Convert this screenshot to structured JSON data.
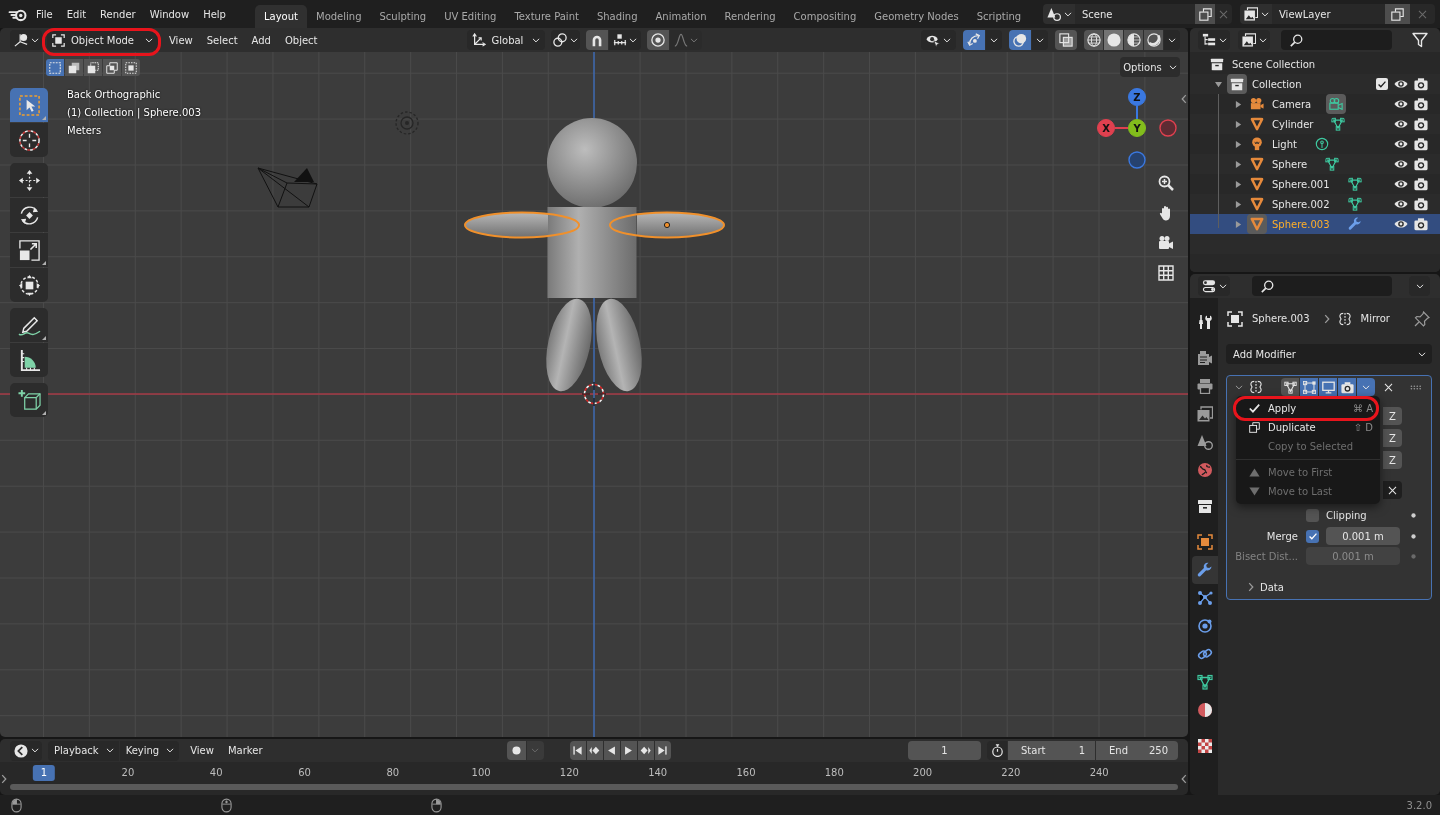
{
  "topbar": {
    "menus": [
      "File",
      "Edit",
      "Render",
      "Window",
      "Help"
    ],
    "workspaces": [
      {
        "label": "Layout",
        "selected": true
      },
      {
        "label": "Modeling",
        "selected": false
      },
      {
        "label": "Sculpting",
        "selected": false
      },
      {
        "label": "UV Editing",
        "selected": false
      },
      {
        "label": "Texture Paint",
        "selected": false
      },
      {
        "label": "Shading",
        "selected": false
      },
      {
        "label": "Animation",
        "selected": false
      },
      {
        "label": "Rendering",
        "selected": false
      },
      {
        "label": "Compositing",
        "selected": false
      },
      {
        "label": "Geometry Nodes",
        "selected": false
      },
      {
        "label": "Scripting",
        "selected": false
      }
    ],
    "scene": "Scene",
    "view_layer": "ViewLayer"
  },
  "viewport": {
    "mode": {
      "label": "Object Mode",
      "annotated": true
    },
    "menus": [
      "View",
      "Select",
      "Add",
      "Object"
    ],
    "orientation": "Global",
    "snap_toggles": [
      {
        "kind": "snap",
        "on": false
      },
      {
        "kind": "proportional",
        "on": false
      }
    ],
    "overlay_toggles": [
      {
        "kind": "gizmos",
        "on": true
      },
      {
        "kind": "overlays",
        "on": true
      },
      {
        "kind": "xray",
        "on": false
      }
    ],
    "shading": [
      {
        "kind": "wireframe",
        "selected": false
      },
      {
        "kind": "solid",
        "selected": true
      },
      {
        "kind": "material",
        "selected": false
      },
      {
        "kind": "rendered",
        "selected": false
      }
    ],
    "select_modes": [
      {
        "kind": "set",
        "selected": true
      },
      {
        "kind": "extend",
        "selected": false
      },
      {
        "kind": "subtract",
        "selected": false
      },
      {
        "kind": "invert",
        "selected": false
      },
      {
        "kind": "intersect",
        "selected": false
      }
    ],
    "options": "Options",
    "tool_groups": [
      {
        "tools": [
          {
            "kind": "select",
            "selected": true,
            "more": true
          },
          {
            "kind": "cursor",
            "selected": false,
            "more": false
          }
        ]
      },
      {
        "tools": [
          {
            "kind": "move",
            "selected": false,
            "more": false
          },
          {
            "kind": "rotate",
            "selected": false,
            "more": false
          },
          {
            "kind": "scale",
            "selected": false,
            "more": true
          },
          {
            "kind": "transform",
            "selected": false,
            "more": false
          }
        ]
      },
      {
        "tools": [
          {
            "kind": "annotate",
            "selected": false,
            "more": true
          },
          {
            "kind": "measure",
            "selected": false,
            "more": false
          }
        ]
      },
      {
        "tools": [
          {
            "kind": "add_cube",
            "selected": false,
            "more": true
          }
        ]
      }
    ],
    "info": [
      "Back Orthographic",
      "(1) Collection | Sphere.003",
      "Meters"
    ],
    "parts": [
      {
        "kind": "head",
        "selected": false,
        "active": false
      },
      {
        "kind": "torso",
        "selected": false,
        "active": false
      },
      {
        "kind": "left_arm",
        "selected": true,
        "active": false
      },
      {
        "kind": "right_arm",
        "selected": true,
        "active": true
      },
      {
        "kind": "left_leg",
        "selected": false,
        "active": false
      },
      {
        "kind": "right_leg",
        "selected": false,
        "active": false
      }
    ],
    "gizmo": [
      {
        "kind": "z",
        "label": "Z"
      },
      {
        "kind": "x",
        "label": "X"
      },
      {
        "kind": "y",
        "label": "Y"
      },
      {
        "kind": "neg_x"
      },
      {
        "kind": "neg_z"
      }
    ]
  },
  "outliner": {
    "tree": [
      {
        "label": "Scene Collection",
        "kind": "scene_collection",
        "children": [
          {
            "label": "Collection",
            "kind": "collection",
            "expanded": true,
            "active": true,
            "checked": true,
            "children": [
              {
                "label": "Camera",
                "kind": "camera",
                "data": {
                  "kind": "camera",
                  "active": true
                },
                "expanded": false,
                "active": false,
                "selected": false
              },
              {
                "label": "Cylinder",
                "kind": "mesh",
                "data": {
                  "kind": "mesh",
                  "active": false
                },
                "expanded": false,
                "active": false,
                "selected": false
              },
              {
                "label": "Light",
                "kind": "light",
                "data": {
                  "kind": "light",
                  "active": false
                },
                "expanded": false,
                "active": false,
                "selected": false
              },
              {
                "label": "Sphere",
                "kind": "mesh",
                "data": {
                  "kind": "mesh",
                  "active": false
                },
                "expanded": false,
                "active": false,
                "selected": false
              },
              {
                "label": "Sphere.001",
                "kind": "mesh",
                "data": {
                  "kind": "mesh",
                  "active": false
                },
                "expanded": false,
                "active": false,
                "selected": false
              },
              {
                "label": "Sphere.002",
                "kind": "mesh",
                "data": {
                  "kind": "mesh",
                  "active": false
                },
                "expanded": false,
                "active": false,
                "selected": false
              },
              {
                "label": "Sphere.003",
                "kind": "mesh",
                "data": {
                  "kind": "modifier",
                  "active": false
                },
                "expanded": false,
                "active": true,
                "selected": true
              }
            ]
          }
        ]
      }
    ]
  },
  "properties": {
    "tab_groups": [
      {
        "tabs": [
          {
            "kind": "tool",
            "selected": false
          }
        ]
      },
      {
        "tabs": [
          {
            "kind": "render",
            "selected": false
          },
          {
            "kind": "output",
            "selected": false
          },
          {
            "kind": "view_layer",
            "selected": false
          },
          {
            "kind": "scene",
            "selected": false
          },
          {
            "kind": "world",
            "selected": false
          }
        ]
      },
      {
        "tabs": [
          {
            "kind": "collection",
            "selected": false
          }
        ]
      },
      {
        "tabs": [
          {
            "kind": "object",
            "selected": false
          },
          {
            "kind": "modifiers",
            "selected": true
          },
          {
            "kind": "particles",
            "selected": false
          },
          {
            "kind": "physics",
            "selected": false
          },
          {
            "kind": "constraints",
            "selected": false
          },
          {
            "kind": "data",
            "selected": false
          },
          {
            "kind": "material",
            "selected": false
          }
        ]
      },
      {
        "tabs": [
          {
            "kind": "texture",
            "selected": false
          }
        ]
      }
    ],
    "object": "Sphere.003",
    "modifier_name": "Mirror",
    "add_modifier": "Add Modifier",
    "modifier": {
      "active": true,
      "expanded": true,
      "toggles": [
        {
          "kind": "edit_mode",
          "on": false
        },
        {
          "kind": "on_cage",
          "on": true
        },
        {
          "kind": "viewport",
          "on": true
        },
        {
          "kind": "render",
          "on": true
        }
      ],
      "menu_open": true,
      "menu_sections": [
        {
          "items": [
            {
              "kind": "apply",
              "label": "Apply",
              "shortcut": "⌘ A",
              "disabled": false,
              "annotated": true
            },
            {
              "kind": "duplicate",
              "label": "Duplicate",
              "shortcut": "⇧ D",
              "disabled": false,
              "annotated": false
            },
            {
              "kind": "copy",
              "label": "Copy to Selected",
              "disabled": true,
              "annotated": false
            }
          ]
        },
        {
          "items": [
            {
              "kind": "move_first",
              "label": "Move to First",
              "disabled": true,
              "annotated": false
            },
            {
              "kind": "move_last",
              "label": "Move to Last",
              "disabled": true,
              "annotated": false
            }
          ]
        }
      ],
      "axis_buttons": [
        "Z",
        "Z",
        "Z"
      ],
      "clipping": {
        "label": "Clipping",
        "checked": false
      },
      "merge": {
        "label": "Merge",
        "checked": true,
        "value": "0.001 m"
      },
      "bisect": {
        "label": "Bisect Dist...",
        "value": "0.001 m",
        "disabled": true
      },
      "subpanel": {
        "label": "Data",
        "expanded": false
      }
    }
  },
  "timeline": {
    "dropdowns": [
      "Playback",
      "Keying"
    ],
    "menus": [
      "View",
      "Marker"
    ],
    "auto_key": false,
    "current_frame": "1",
    "start": {
      "label": "Start",
      "value": "1"
    },
    "end": {
      "label": "End",
      "value": "250"
    },
    "frames": [
      {
        "label": "1",
        "selected": true
      },
      {
        "label": "20",
        "selected": false
      },
      {
        "label": "40",
        "selected": false
      },
      {
        "label": "60",
        "selected": false
      },
      {
        "label": "80",
        "selected": false
      },
      {
        "label": "100",
        "selected": false
      },
      {
        "label": "120",
        "selected": false
      },
      {
        "label": "140",
        "selected": false
      },
      {
        "label": "160",
        "selected": false
      },
      {
        "label": "180",
        "selected": false
      },
      {
        "label": "200",
        "selected": false
      },
      {
        "label": "220",
        "selected": false
      },
      {
        "label": "240",
        "selected": false
      }
    ]
  },
  "status_bar": {
    "version": "3.2.0"
  }
}
